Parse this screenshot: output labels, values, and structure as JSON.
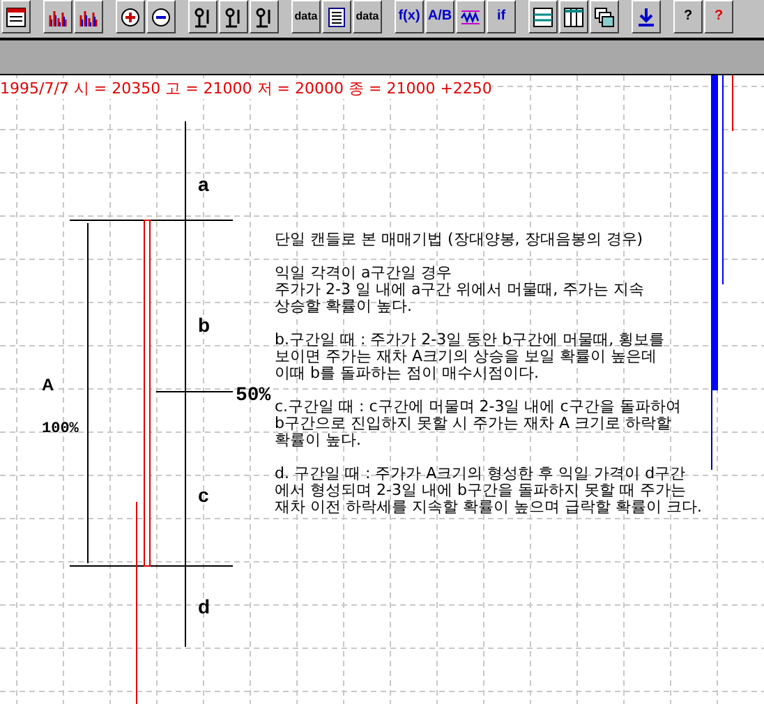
{
  "toolbar": [
    [
      {
        "kind": "calendar"
      }
    ],
    [
      {
        "kind": "bars"
      },
      {
        "kind": "bars"
      }
    ],
    [
      {
        "kind": "zoom-in"
      },
      {
        "kind": "zoom-out"
      }
    ],
    [
      {
        "kind": "tool"
      },
      {
        "kind": "tool"
      },
      {
        "kind": "tool"
      }
    ],
    [
      {
        "kind": "data",
        "label": "data"
      },
      {
        "kind": "list"
      },
      {
        "kind": "data",
        "label": "data"
      }
    ],
    [
      {
        "kind": "formula",
        "label": "f(x)"
      },
      {
        "kind": "formula",
        "label": "A/B"
      },
      {
        "kind": "wave"
      },
      {
        "kind": "formula",
        "label": "if"
      }
    ],
    [
      {
        "kind": "rows"
      },
      {
        "kind": "columns"
      },
      {
        "kind": "windows"
      }
    ],
    [
      {
        "kind": "down"
      }
    ],
    [
      {
        "kind": "help",
        "label": "?"
      },
      {
        "kind": "help-cursor",
        "label": "?"
      }
    ]
  ],
  "info_line": "1995/7/7 시 = 20350 고 = 21000 저 = 20000 종 = 21000 +2250",
  "chart": {
    "zones": [
      "a",
      "b",
      "c",
      "d"
    ],
    "size_label": "A",
    "full_label": "100%",
    "mid_label": "50%"
  },
  "notes": {
    "title": "단일 캔들로 본 매매기법 (장대양봉, 장대음봉의 경우)",
    "paragraphs": [
      [
        "익일 각격이 a구간일 경우",
        "주가가 2-3 일 내에 a구간 위에서 머물때, 주가는 지속",
        "상승할 확률이 높다."
      ],
      [
        "b.구간일 때 : 주가가 2-3일 동안 b구간에 머물때, 횡보를",
        "보이면 주가는 재차 A크기의 상승을 보일 확률이 높은데",
        "이때 b를 돌파하는 점이 매수시점이다."
      ],
      [
        "c.구간일 때 : c구간에 머물며 2-3일 내에 c구간을 돌파하여",
        "b구간으로 진입하지 못할 시 주가는 재차 A 크기로 하락할",
        "확률이 높다."
      ],
      [
        "d. 구간일 때 : 주가가 A크기의 형성한 후 익일 가격이 d구간",
        "에서 형성되며 2-3일 내에 b구간을 돌파하지 못할 때 주가는",
        "재차 이전 하락세를 지속할 확률이 높으며 급락할 확률이 크다."
      ]
    ]
  }
}
